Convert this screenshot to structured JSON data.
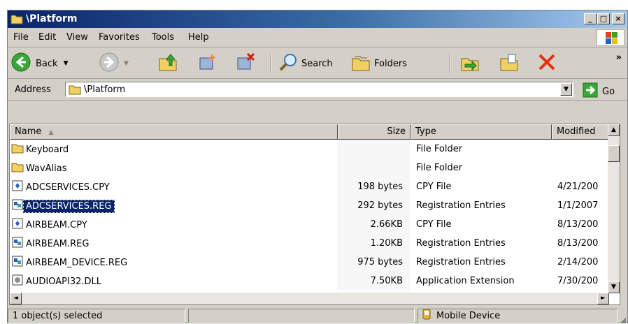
{
  "window": {
    "title": "\\Platform"
  },
  "menu": {
    "file": "File",
    "edit": "Edit",
    "view": "View",
    "favorites": "Favorites",
    "tools": "Tools",
    "help": "Help"
  },
  "toolbar": {
    "back": "Back",
    "search": "Search",
    "folders": "Folders",
    "more": "»"
  },
  "address": {
    "label": "Address",
    "value": "\\Platform",
    "go": "Go"
  },
  "columns": {
    "name": "Name",
    "size": "Size",
    "type": "Type",
    "modified": "Modified"
  },
  "files": [
    {
      "name": "Keyboard",
      "size": "",
      "type": "File Folder",
      "modified": "",
      "icon": "folder-icon"
    },
    {
      "name": "WavAlias",
      "size": "",
      "type": "File Folder",
      "modified": "",
      "icon": "folder-icon"
    },
    {
      "name": "ADCSERVICES.CPY",
      "size": "198 bytes",
      "type": "CPY File",
      "modified": "4/21/200",
      "icon": "file-icon"
    },
    {
      "name": "ADCSERVICES.REG",
      "size": "292 bytes",
      "type": "Registration Entries",
      "modified": "1/1/2007",
      "icon": "registry-file-icon",
      "selected": true
    },
    {
      "name": "AIRBEAM.CPY",
      "size": "2.66KB",
      "type": "CPY File",
      "modified": "8/13/200",
      "icon": "file-icon"
    },
    {
      "name": "AIRBEAM.REG",
      "size": "1.20KB",
      "type": "Registration Entries",
      "modified": "8/13/200",
      "icon": "registry-file-icon"
    },
    {
      "name": "AIRBEAM_DEVICE.REG",
      "size": "975 bytes",
      "type": "Registration Entries",
      "modified": "2/14/200",
      "icon": "registry-file-icon"
    },
    {
      "name": "AUDIOAPI32.DLL",
      "size": "7.50KB",
      "type": "Application Extension",
      "modified": "7/30/200",
      "icon": "dll-file-icon"
    }
  ],
  "status": {
    "selection": "1 object(s) selected",
    "middle": "",
    "location": "Mobile Device"
  }
}
